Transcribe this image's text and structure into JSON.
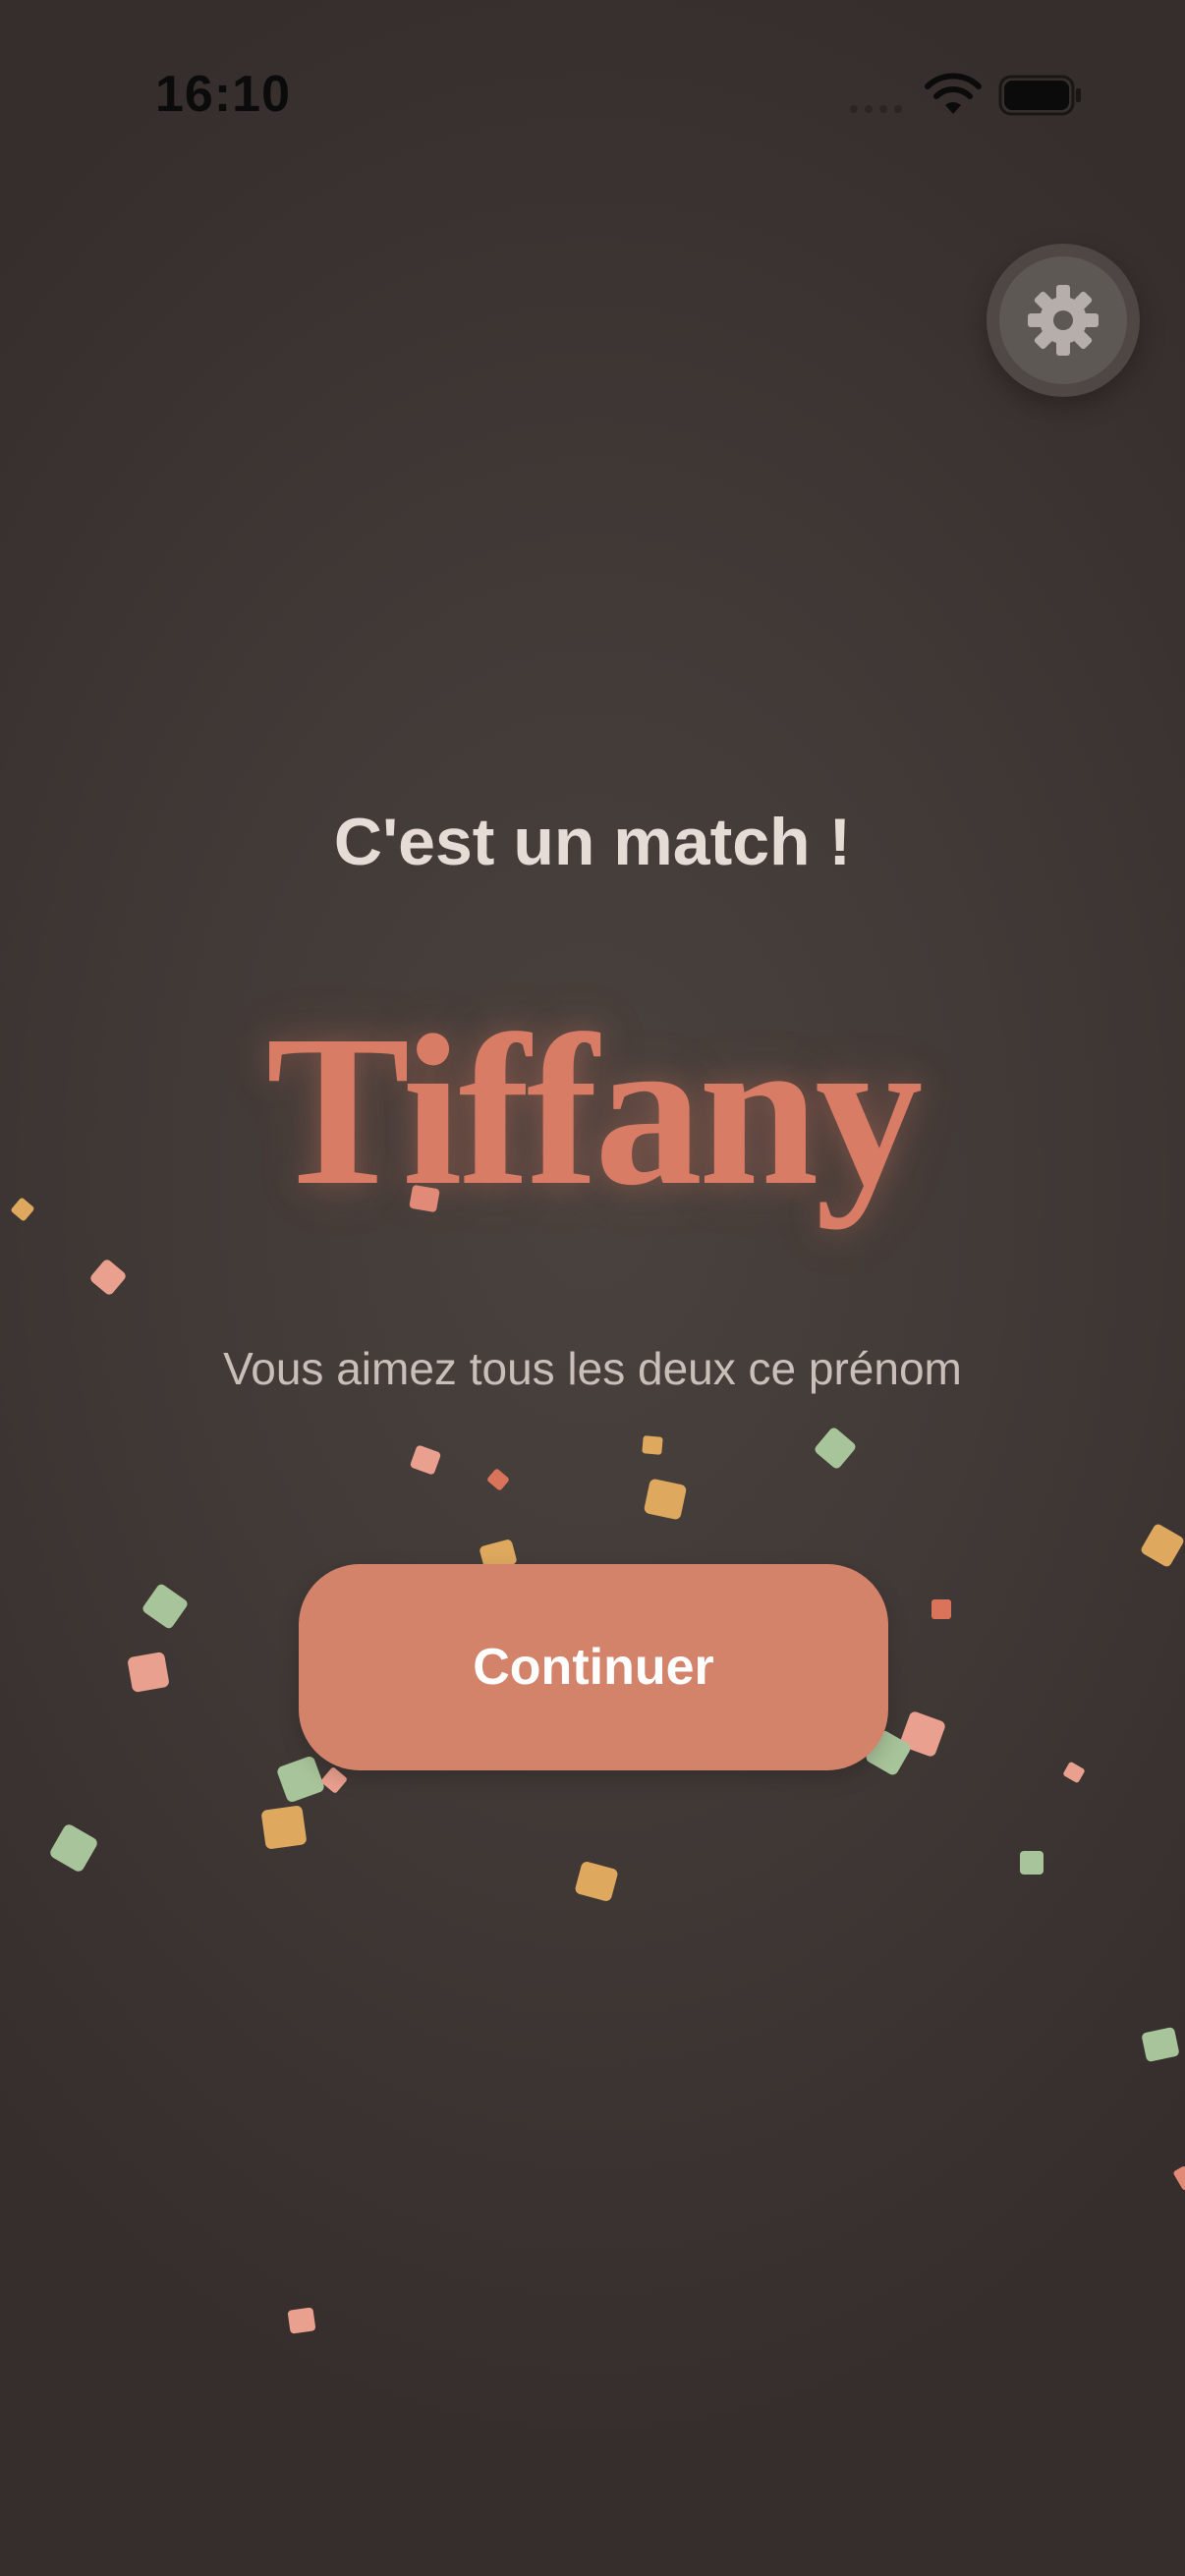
{
  "status_bar": {
    "time": "16:10"
  },
  "match": {
    "headline": "C'est un match !",
    "name": "Tiffany",
    "subtitle": "Vous aimez tous les deux ce prénom"
  },
  "actions": {
    "continue_label": "Continuer"
  },
  "icons": {
    "settings": "gear-icon",
    "wifi": "wifi-icon",
    "battery": "battery-icon",
    "signal": "signal-icon"
  },
  "colors": {
    "accent": "#d4836b",
    "name": "#d97c65",
    "background": "#423a37",
    "confetti_orange": "#dea95f",
    "confetti_pink": "#eaa08f",
    "confetti_green": "#a8c49a",
    "confetti_coral": "#d9735a"
  }
}
